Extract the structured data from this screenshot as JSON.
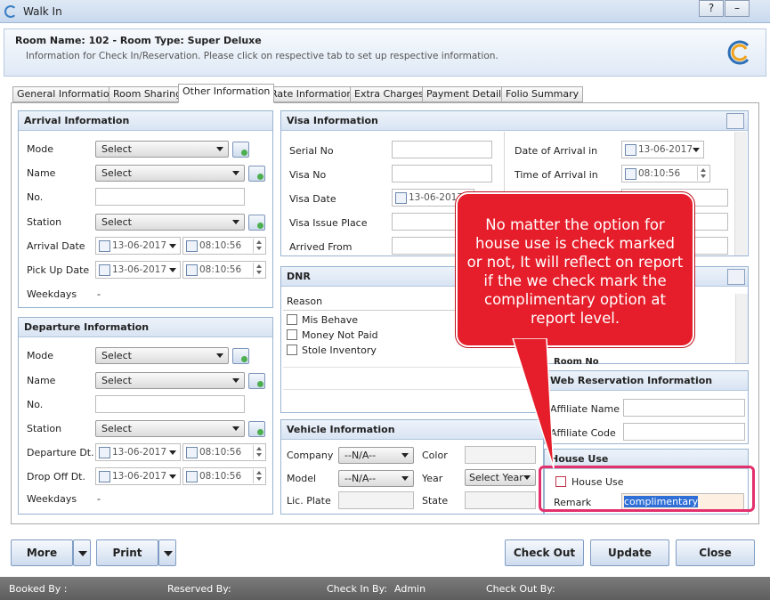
{
  "window": {
    "title": "Walk In",
    "help": "?",
    "minimize": "–",
    "close": "✕"
  },
  "header": {
    "room": "Room Name: 102 - Room Type: Super Deluxe",
    "subtitle": "Information for Check In/Reservation. Please click on respective tab to set up respective information."
  },
  "tabs": [
    "General Information",
    "Room Sharing",
    "Other Information",
    "Rate Information",
    "Extra Charges",
    "Payment Details",
    "Folio Summary"
  ],
  "arrival": {
    "title": "Arrival Information",
    "mode_label": "Mode",
    "mode": "Select",
    "name_label": "Name",
    "name": "Select",
    "no_label": "No.",
    "station_label": "Station",
    "station": "Select",
    "arrival_date_label": "Arrival Date",
    "arrival_date": "13-06-2017",
    "arrival_time": "08:10:56",
    "pickup_label": "Pick Up Date",
    "pickup_date": "13-06-2017",
    "pickup_time": "08:10:56",
    "weekdays_label": "Weekdays",
    "weekdays": "-"
  },
  "departure": {
    "title": "Departure Information",
    "mode_label": "Mode",
    "mode": "Select",
    "name_label": "Name",
    "name": "Select",
    "no_label": "No.",
    "station_label": "Station",
    "station": "Select",
    "dep_label": "Departure Dt.",
    "dep_date": "13-06-2017",
    "dep_time": "08:10:56",
    "drop_label": "Drop Off Dt.",
    "drop_date": "13-06-2017",
    "drop_time": "08:10:56",
    "weekdays_label": "Weekdays",
    "weekdays": "-"
  },
  "visa": {
    "title": "Visa Information",
    "serial_label": "Serial No",
    "visa_label": "Visa No",
    "visa_date_label": "Visa Date",
    "visa_date": "13-06-2017",
    "issue_place_label": "Visa Issue Place",
    "arrived_from_label": "Arrived From",
    "doa_label": "Date of Arrival in",
    "doa": "13-06-2017",
    "toa_label": "Time of Arrival in",
    "toa": "08:10:56"
  },
  "dnr": {
    "title": "DNR",
    "reason_header": "Reason",
    "reasons": [
      "Mis Behave",
      "Money Not Paid",
      "Stole Inventory"
    ]
  },
  "vehicle": {
    "title": "Vehicle Information",
    "company_label": "Company",
    "company": "--N/A--",
    "color_label": "Color",
    "model_label": "Model",
    "model": "--N/A--",
    "year_label": "Year",
    "year": "Select Year",
    "plate_label": "Lic. Plate",
    "state_label": "State"
  },
  "room_no_partial": "Room No",
  "web": {
    "title": "Web Reservation Information",
    "affiliate_name_label": "Affiliate Name",
    "affiliate_code_label": "Affiliate Code"
  },
  "house": {
    "title": "House Use",
    "house_use_label": "House Use",
    "remark_label": "Remark",
    "remark": "complimentary"
  },
  "callout": "No matter the option for house use is check marked or not, It will reflect on report if the we check mark the complimentary option at report level.",
  "buttons": {
    "more": "More",
    "print": "Print",
    "check_out": "Check Out",
    "update": "Update",
    "close": "Close"
  },
  "status": {
    "booked_by": "Booked By :",
    "reserved_by": "Reserved By:",
    "check_in_by": "Check In By:",
    "check_in_by_value": "Admin",
    "check_out_by": "Check Out By:"
  },
  "colors": {
    "callout": "#e61d2a",
    "highlight": "#e2306c",
    "panel_header": "#d8e4f3"
  }
}
